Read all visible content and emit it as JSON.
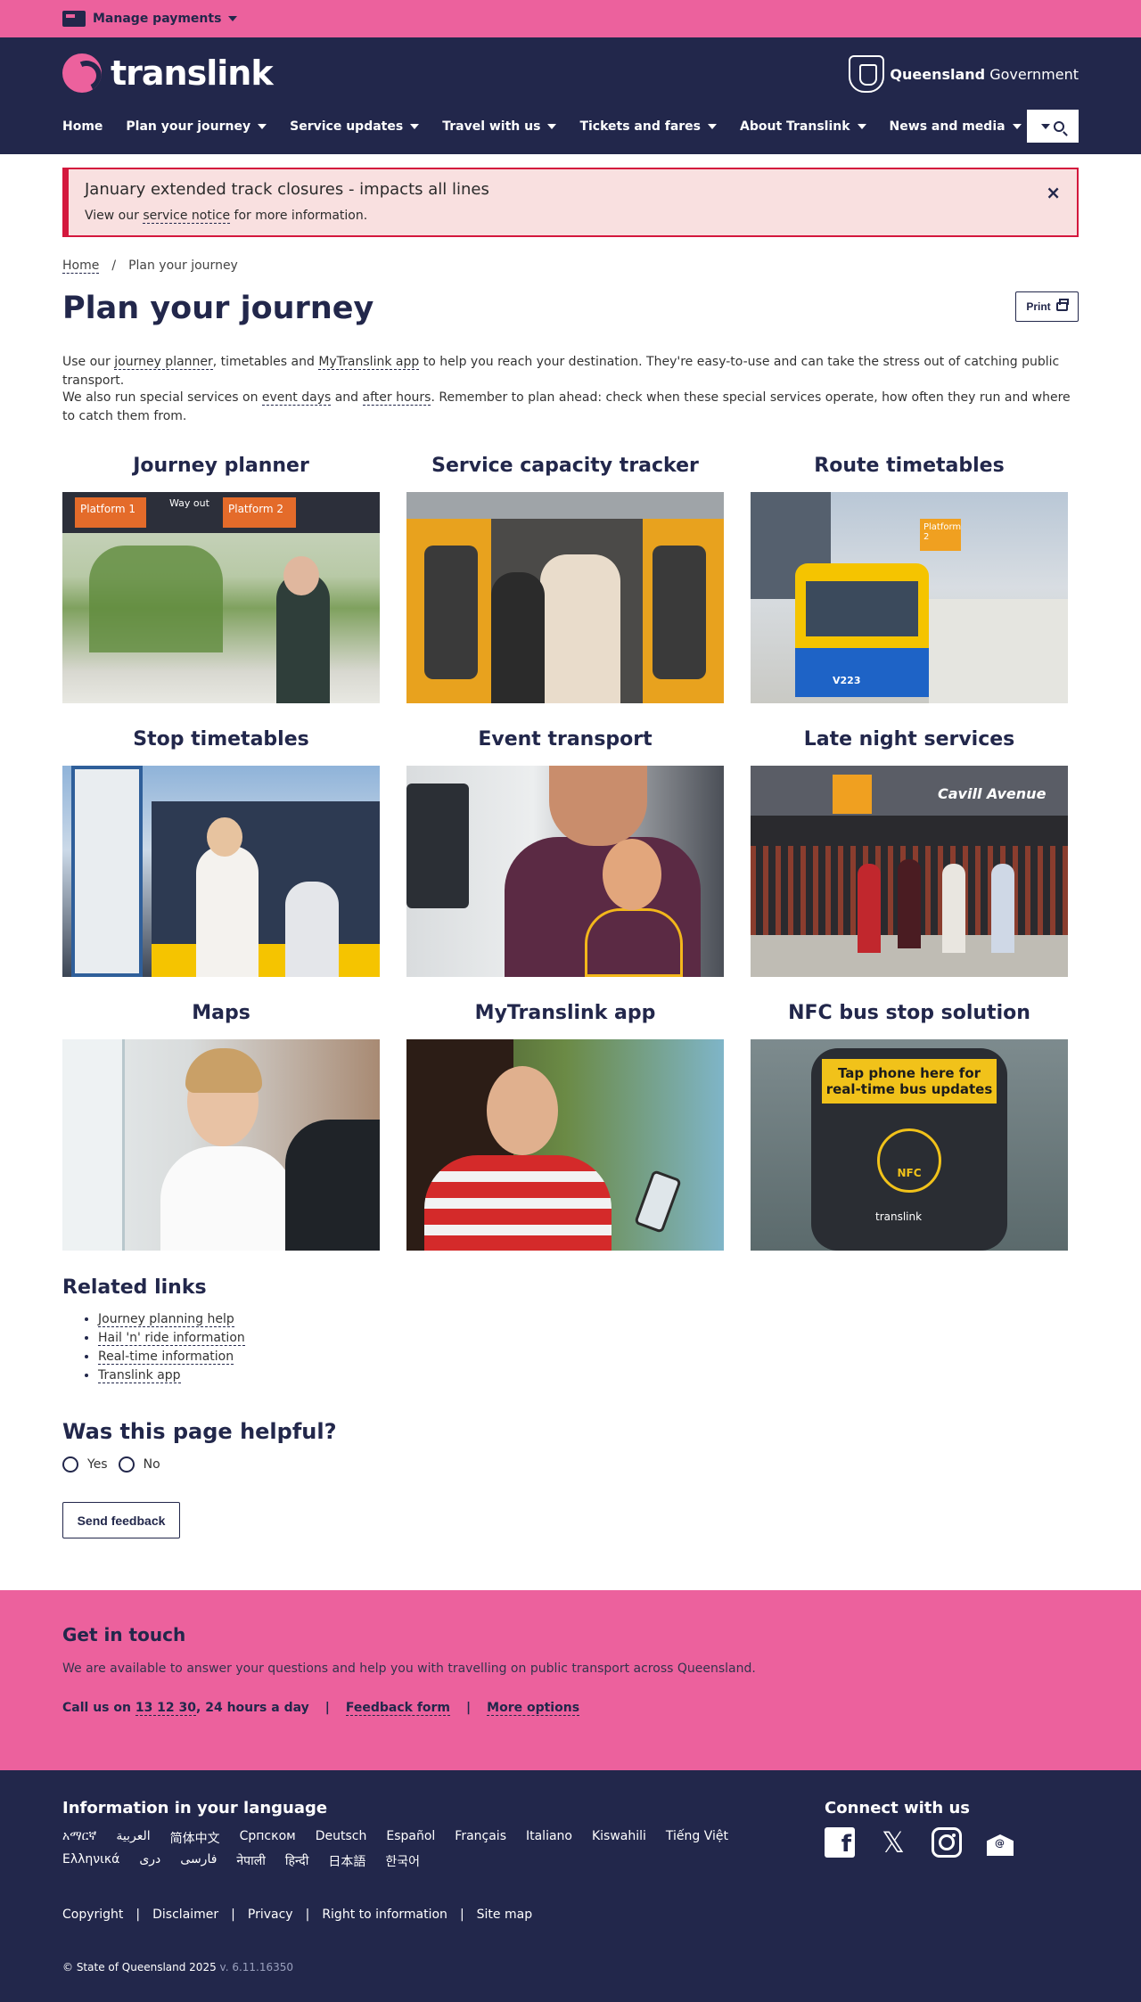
{
  "util": {
    "manage_payments": "Manage payments"
  },
  "header": {
    "logo_text": "translink",
    "qg_bold": "Queensland",
    "qg_regular": " Government",
    "nav": [
      {
        "label": "Home",
        "dropdown": false
      },
      {
        "label": "Plan your journey",
        "dropdown": true
      },
      {
        "label": "Service updates",
        "dropdown": true
      },
      {
        "label": "Travel with us",
        "dropdown": true
      },
      {
        "label": "Tickets and fares",
        "dropdown": true
      },
      {
        "label": "About Translink",
        "dropdown": true
      },
      {
        "label": "News and media",
        "dropdown": true
      }
    ]
  },
  "alert": {
    "title": "January extended track closures - impacts all lines",
    "text_before": "View our ",
    "link": "service notice",
    "text_after": " for more information.",
    "close": "×"
  },
  "breadcrumb": {
    "home": "Home",
    "sep": "/",
    "current": "Plan your journey"
  },
  "page": {
    "title": "Plan your journey",
    "print": "Print",
    "intro1": {
      "t1": "Use our ",
      "l1": "journey planner",
      "t2": ", timetables and ",
      "l2": "MyTranslink app",
      "t3": " to help you reach your destination. They're easy-to-use and can take the stress out of catching public transport."
    },
    "intro2": {
      "t1": "We also run special services on ",
      "l1": "event days",
      "t2": " and ",
      "l2": "after hours",
      "t3": ". Remember to plan ahead: check when these special services operate, how often they run and where to catch them from."
    }
  },
  "tiles": [
    {
      "title": "Journey planner"
    },
    {
      "title": "Service capacity tracker"
    },
    {
      "title": "Route timetables"
    },
    {
      "title": "Stop timetables"
    },
    {
      "title": "Event transport"
    },
    {
      "title": "Late night services"
    },
    {
      "title": "Maps"
    },
    {
      "title": "MyTranslink app"
    },
    {
      "title": "NFC bus stop solution"
    }
  ],
  "image_text": {
    "platform1": "Platform 1",
    "way_out": "Way out",
    "platform2": "Platform 2",
    "cavill": "Cavill Avenue",
    "nfc_line1": "Tap phone here for",
    "nfc_line2": "real-time bus updates",
    "nfc": "NFC",
    "nfc_brand": "translink",
    "bus_number": "V223"
  },
  "related": {
    "heading": "Related links",
    "links": [
      "Journey planning help",
      "Hail 'n' ride information",
      "Real-time information",
      "Translink app"
    ]
  },
  "feedback": {
    "heading": "Was this page helpful?",
    "yes": "Yes",
    "no": "No",
    "button": "Send feedback"
  },
  "touch": {
    "heading": "Get in touch",
    "text": "We are available to answer your questions and help you with travelling on public transport across Queensland.",
    "call_prefix": "Call us on ",
    "phone": "13 12 30",
    "call_suffix": ", 24 hours a day",
    "sep": "|",
    "feedback_form": "Feedback form",
    "more_options": "More options"
  },
  "footer": {
    "lang_heading": "Information in your language",
    "languages": [
      "አማርኛ",
      "العربية",
      "简体中文",
      "Српском",
      "Deutsch",
      "Español",
      "Français",
      "Italiano",
      "Kiswahili",
      "Tiếng Việt",
      "Ελληνικά",
      "دری",
      "فارسی",
      "नेपाली",
      "हिन्दी",
      "日本語",
      "한국어"
    ],
    "connect_heading": "Connect with us",
    "social": [
      "facebook-icon",
      "x-icon",
      "instagram-icon",
      "email-icon"
    ],
    "legal": [
      "Copyright",
      "Disclaimer",
      "Privacy",
      "Right to information",
      "Site map"
    ],
    "sep": "|",
    "copyright": "© State of Queensland 2025",
    "version": " v. 6.11.16350"
  },
  "colors": {
    "navy": "#22274b",
    "pink": "#ec619d",
    "alert_border": "#d4183d",
    "alert_bg": "#f9e0e0"
  }
}
